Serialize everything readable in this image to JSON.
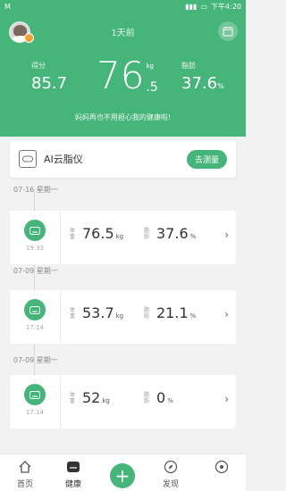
{
  "status_bar": {
    "carrier": "M",
    "time": "下午4:20"
  },
  "header": {
    "time_ago": "1天前",
    "score_label": "得分",
    "score_value": "85.7",
    "weight_int": "76",
    "weight_unit": "kg",
    "weight_dec": ".5",
    "fat_label": "脂肪",
    "fat_value": "37.6",
    "fat_unit": "%",
    "slogan": "妈妈再也不用担心我的健康啦!"
  },
  "device": {
    "name": "AI云脂仪",
    "button": "去测量"
  },
  "records": [
    {
      "date": "07-16 星期一",
      "time": "19:33",
      "weight_label": "体重",
      "weight": "76.5",
      "weight_unit": "kg",
      "fat_label": "脂肪",
      "fat": "37.6",
      "fat_unit": "%"
    },
    {
      "date": "07-09 星期一",
      "time": "17:14",
      "weight_label": "体重",
      "weight": "53.7",
      "weight_unit": "kg",
      "fat_label": "脂肪",
      "fat": "21.1",
      "fat_unit": "%"
    },
    {
      "date": "07-09 星期一",
      "time": "17:14",
      "weight_label": "体重",
      "weight": "52",
      "weight_unit": "kg",
      "fat_label": "脂肪",
      "fat": "0",
      "fat_unit": "%"
    }
  ],
  "nav": {
    "home": "首页",
    "health": "健康",
    "discover": "发现"
  },
  "colors": {
    "brand": "#45b57a"
  }
}
